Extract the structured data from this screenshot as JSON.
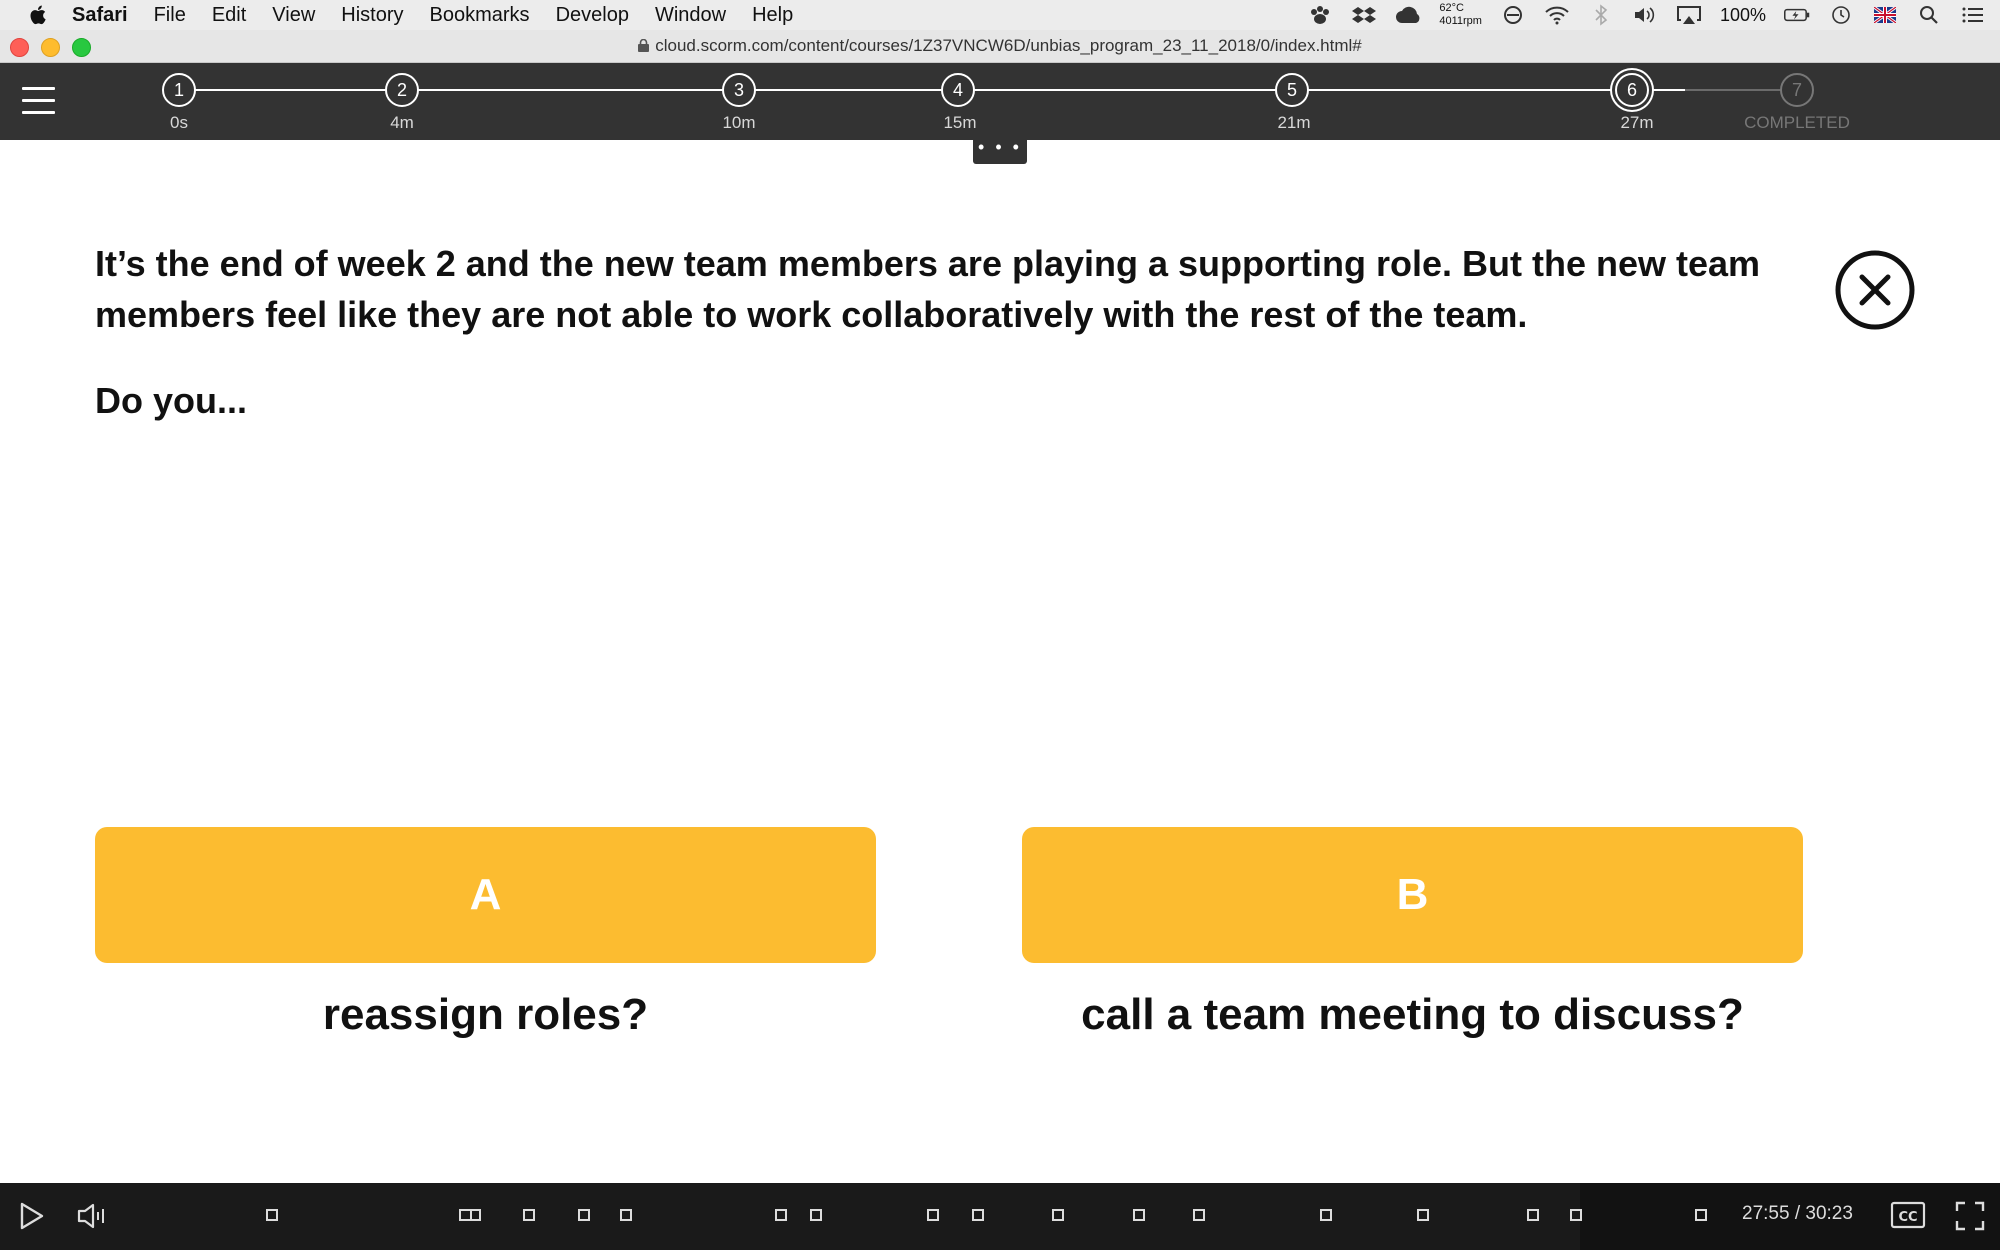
{
  "menubar": {
    "app_name": "Safari",
    "items": [
      "File",
      "Edit",
      "View",
      "History",
      "Bookmarks",
      "Develop",
      "Window",
      "Help"
    ],
    "temperature": "62°C",
    "fan": "4011rpm",
    "battery": "100%"
  },
  "browser": {
    "url": "cloud.scorm.com/content/courses/1Z37VNCW6D/unbias_program_23_11_2018/0/index.html#"
  },
  "progress": {
    "steps": [
      {
        "number": "1",
        "label": "0s",
        "state": "done"
      },
      {
        "number": "2",
        "label": "4m",
        "state": "done"
      },
      {
        "number": "3",
        "label": "10m",
        "state": "done"
      },
      {
        "number": "4",
        "label": "15m",
        "state": "done"
      },
      {
        "number": "5",
        "label": "21m",
        "state": "done"
      },
      {
        "number": "6",
        "label": "27m",
        "state": "current"
      },
      {
        "number": "7",
        "label": "COMPLETED",
        "state": "todo"
      }
    ],
    "more_label": "• • •"
  },
  "content": {
    "scenario": "It’s the end of week 2 and the new team members are playing a supporting role. But the new team members feel like they are not able to work collaboratively with the rest of the team.",
    "prompt": "Do you...",
    "choices": [
      {
        "letter": "A",
        "text": "reassign roles?"
      },
      {
        "letter": "B",
        "text": "call a team meeting to discuss?"
      }
    ]
  },
  "player": {
    "time": "27:55 / 30:23",
    "cc_label": "CC"
  },
  "colors": {
    "choice_button": "#fcbc30",
    "header_bg": "#333333",
    "player_bg": "#1a1a1a"
  },
  "icons": [
    "apple-icon",
    "hamburger-menu-icon",
    "close-circle-icon",
    "play-icon",
    "volume-icon",
    "closed-captions-icon",
    "fullscreen-icon",
    "wifi-icon",
    "search-icon"
  ]
}
